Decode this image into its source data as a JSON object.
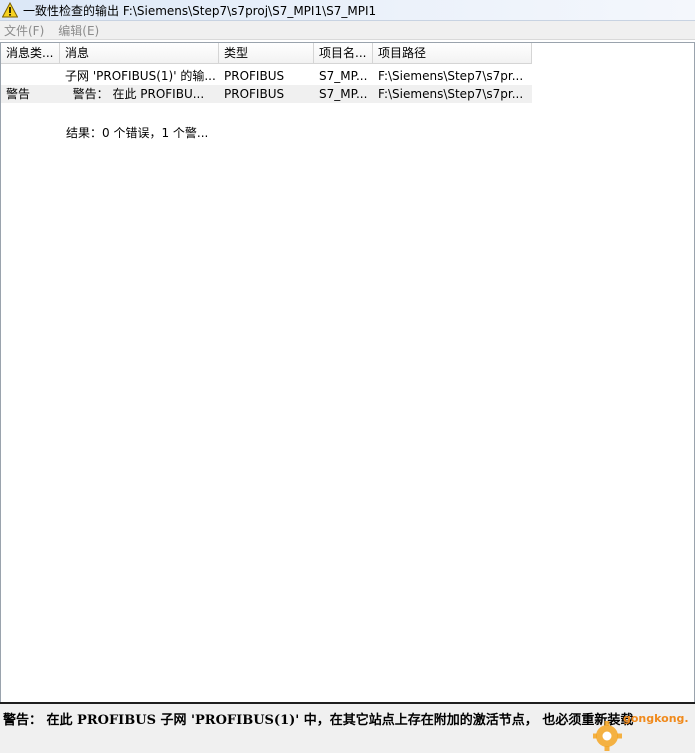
{
  "window": {
    "title": "一致性检查的输出  F:\\Siemens\\Step7\\s7proj\\S7_MPI1\\S7_MPI1",
    "icon": "warning-icon"
  },
  "menu": [
    "文件(F)",
    "编辑(E)"
  ],
  "columns": [
    "消息类...",
    "消息",
    "类型",
    "项目名...",
    "项目路径"
  ],
  "rows": [
    {
      "category": "",
      "message": "子网 'PROFIBUS(1)' 的输...",
      "type": "PROFIBUS",
      "project": "S7_MP...",
      "path": "F:\\Siemens\\Step7\\s7pr..."
    },
    {
      "category": "警告",
      "message": "  警告： 在此 PROFIBU...",
      "type": "PROFIBUS",
      "project": "S7_MP...",
      "path": "F:\\Siemens\\Step7\\s7pr..."
    }
  ],
  "summary": "结果：0 个错误，1 个警...",
  "status": "警告： 在此 PROFIBUS 子网 'PROFIBUS(1)' 中，在其它站点上存在附加的激活节点， 也必须重新装载",
  "watermark": {
    "text": "gongkong.com",
    "icon": "gear-logo-icon"
  }
}
